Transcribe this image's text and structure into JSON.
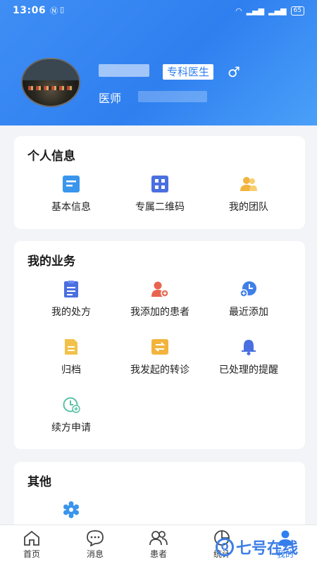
{
  "status_bar": {
    "time": "13:06",
    "battery": "65"
  },
  "profile": {
    "tag": "专科医生",
    "gender_symbol": "♂",
    "role": "医师"
  },
  "colors": {
    "primary": "#2f7ff0",
    "header_gradient": [
      "#3f8ef5",
      "#4aa0f8"
    ]
  },
  "sections": {
    "personal": {
      "title": "个人信息",
      "items": [
        {
          "label": "基本信息",
          "icon": "profile-card-icon"
        },
        {
          "label": "专属二维码",
          "icon": "qr-code-icon"
        },
        {
          "label": "我的团队",
          "icon": "team-icon"
        }
      ]
    },
    "business": {
      "title": "我的业务",
      "items": [
        {
          "label": "我的处方",
          "icon": "prescription-icon"
        },
        {
          "label": "我添加的患者",
          "icon": "add-patient-icon"
        },
        {
          "label": "最近添加",
          "icon": "recent-add-icon"
        },
        {
          "label": "归档",
          "icon": "archive-icon"
        },
        {
          "label": "我发起的转诊",
          "icon": "referral-icon"
        },
        {
          "label": "已处理的提醒",
          "icon": "bell-icon"
        },
        {
          "label": "续方申请",
          "icon": "renewal-icon"
        }
      ]
    },
    "other": {
      "title": "其他",
      "items": [
        {
          "icon": "settings-icon"
        }
      ]
    }
  },
  "tabbar": [
    {
      "label": "首页",
      "icon": "home-icon"
    },
    {
      "label": "消息",
      "icon": "message-icon"
    },
    {
      "label": "患者",
      "icon": "patients-icon"
    },
    {
      "label": "统计",
      "icon": "stats-icon"
    },
    {
      "label": "我的",
      "icon": "me-icon",
      "active": true
    }
  ],
  "watermark": {
    "text": "七号在线"
  }
}
